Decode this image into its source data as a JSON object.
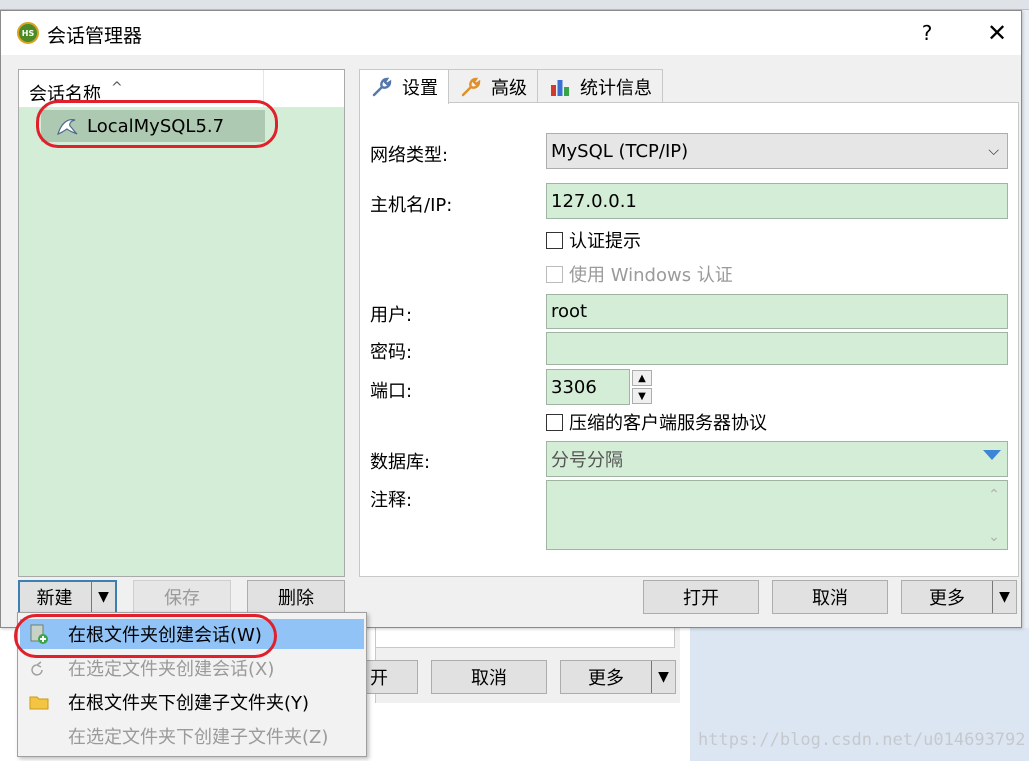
{
  "window": {
    "title": "会话管理器",
    "help_label": "?",
    "close_label": "✕",
    "icon_text": "HS"
  },
  "session_list": {
    "header": "会话名称",
    "sort_indicator": "^",
    "items": [
      {
        "label": "LocalMySQL5.7",
        "icon": "dolphin-icon",
        "selected": true
      }
    ]
  },
  "tabs": [
    {
      "label": "设置",
      "icon": "wrench-icon",
      "active": true
    },
    {
      "label": "高级",
      "icon": "wrench-orange-icon",
      "active": false
    },
    {
      "label": "统计信息",
      "icon": "bar-chart-icon",
      "active": false
    }
  ],
  "settings": {
    "network_type_label": "网络类型:",
    "network_type_value": "MySQL (TCP/IP)",
    "host_label": "主机名/IP:",
    "host_value": "127.0.0.1",
    "auth_prompt_label": "认证提示",
    "auth_prompt_checked": false,
    "windows_auth_label": "使用 Windows 认证",
    "windows_auth_checked": false,
    "windows_auth_enabled": false,
    "user_label": "用户:",
    "user_value": "root",
    "password_label": "密码:",
    "password_value": "",
    "port_label": "端口:",
    "port_value": "3306",
    "compress_label": "压缩的客户端服务器协议",
    "compress_checked": false,
    "database_label": "数据库:",
    "database_placeholder": "分号分隔",
    "comment_label": "注释:",
    "comment_value": ""
  },
  "left_buttons": {
    "new_label": "新建",
    "save_label": "保存",
    "delete_label": "删除"
  },
  "right_buttons": {
    "open_label": "打开",
    "cancel_label": "取消",
    "more_label": "更多"
  },
  "background_buttons": {
    "open_label_partial": "开",
    "cancel_label": "取消",
    "more_label": "更多"
  },
  "new_menu": {
    "items": [
      {
        "label": "在根文件夹创建会话(W)",
        "enabled": true,
        "highlighted": true,
        "icon": "new-session-icon"
      },
      {
        "label": "在选定文件夹创建会话(X)",
        "enabled": false,
        "highlighted": false,
        "icon": "new-session-small-icon"
      },
      {
        "label": "在根文件夹下创建子文件夹(Y)",
        "enabled": true,
        "highlighted": false,
        "icon": "folder-icon"
      },
      {
        "label": "在选定文件夹下创建子文件夹(Z)",
        "enabled": false,
        "highlighted": false,
        "icon": "none"
      }
    ]
  },
  "watermark": "https://blog.csdn.net/u014693792",
  "colors": {
    "field_green": "#d4edd6",
    "selection_green": "#aec9b1",
    "annotation_red": "#e0202a",
    "menu_highlight": "#92c3f7"
  }
}
